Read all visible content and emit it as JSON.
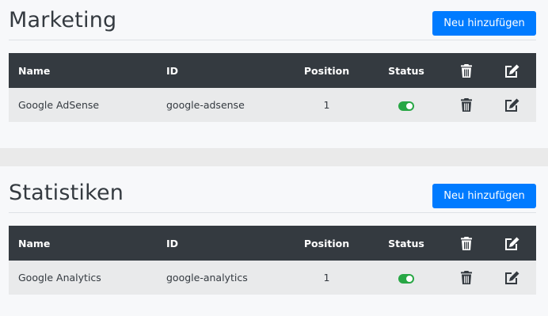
{
  "sections": [
    {
      "title": "Marketing",
      "add_button": "Neu hinzufügen",
      "columns": {
        "name": "Name",
        "id": "ID",
        "position": "Position",
        "status": "Status"
      },
      "header_icons": [
        "trash-icon",
        "edit-icon"
      ],
      "rows": [
        {
          "name": "Google AdSense",
          "id": "google-adsense",
          "position": "1",
          "status_enabled": true
        }
      ]
    },
    {
      "title": "Statistiken",
      "add_button": "Neu hinzufügen",
      "columns": {
        "name": "Name",
        "id": "ID",
        "position": "Position",
        "status": "Status"
      },
      "header_icons": [
        "trash-icon",
        "edit-icon"
      ],
      "rows": [
        {
          "name": "Google Analytics",
          "id": "google-analytics",
          "position": "1",
          "status_enabled": true
        }
      ]
    }
  ],
  "colors": {
    "primary": "#007bff",
    "table_header": "#343a40",
    "row_background": "#e9eaeb",
    "toggle_on": "#28a745",
    "page_background": "#f7f8fa"
  }
}
